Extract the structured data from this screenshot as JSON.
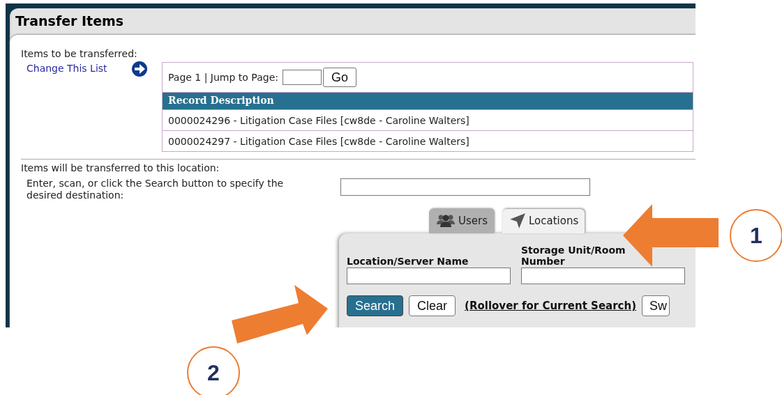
{
  "window": {
    "title": "Transfer Items"
  },
  "items_section": {
    "label": "Items to be transferred:",
    "change_link": "Change This List"
  },
  "pager": {
    "text": "Page 1 | Jump to Page:",
    "button": "Go"
  },
  "table": {
    "columns": [
      "Record Description"
    ],
    "rows": [
      [
        "0000024296 - Litigation Case Files [cw8de - Caroline Walters]"
      ],
      [
        "0000024297 - Litigation Case Files [cw8de - Caroline Walters]"
      ]
    ]
  },
  "destination": {
    "label": "Items will be transferred to this location:",
    "prompt": "Enter, scan, or click the Search button to specify the desired destination:"
  },
  "tabs": [
    {
      "label": "Users",
      "kind": "users",
      "selected": false
    },
    {
      "label": "Locations",
      "kind": "location",
      "selected": true
    }
  ],
  "search_panel": {
    "fields": [
      {
        "label": "Location/Server Name"
      },
      {
        "label": "Storage Unit/Room Number"
      }
    ],
    "buttons": [
      {
        "label": "Search",
        "primary": true
      },
      {
        "label": "Clear",
        "primary": false
      }
    ],
    "rollover_link": "(Rollover for Current Search)",
    "cut_button": "Sw"
  },
  "annotations": [
    {
      "label": "1"
    },
    {
      "label": "2"
    }
  ]
}
